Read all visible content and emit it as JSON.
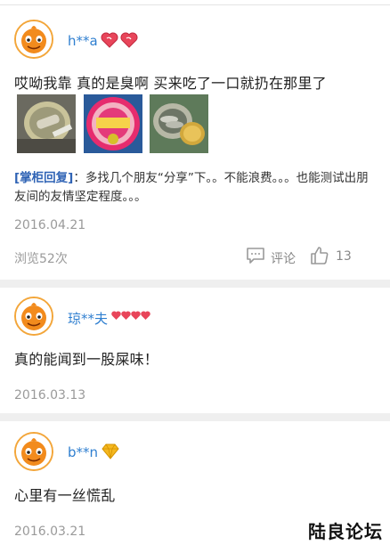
{
  "comments": [
    {
      "username": "h**a",
      "badge_icon": "double-heart-icon",
      "text": "哎呦我靠 真的是臭啊 买来吃了一口就扔在那里了",
      "images": [
        "canned-fish-photo-1",
        "canned-fish-photo-2",
        "canned-fish-photo-3"
      ],
      "reply_tag": "[掌柜回复]",
      "reply_text": "：多找几个朋友“分享”下。。不能浪费。。。也能测试出朋友间的友情坚定程度。。。",
      "date": "2016.04.21",
      "views": "浏览52次",
      "comment_label": "评论",
      "like_count": "13"
    },
    {
      "username": "琼**夫",
      "badge_icon": "four-hearts-icon",
      "text": "真的能闻到一股屎味！",
      "date": "2016.03.13"
    },
    {
      "username": "b**n",
      "badge_icon": "diamond-icon",
      "text": "心里有一丝慌乱",
      "date": "2016.03.21"
    }
  ],
  "watermark": "陆良论坛",
  "colors": {
    "username": "#2f7fd0",
    "reply_tag": "#2f63b5",
    "meta": "#9a9a9a",
    "heart": "#e8455a",
    "diamond": "#f5b820"
  }
}
